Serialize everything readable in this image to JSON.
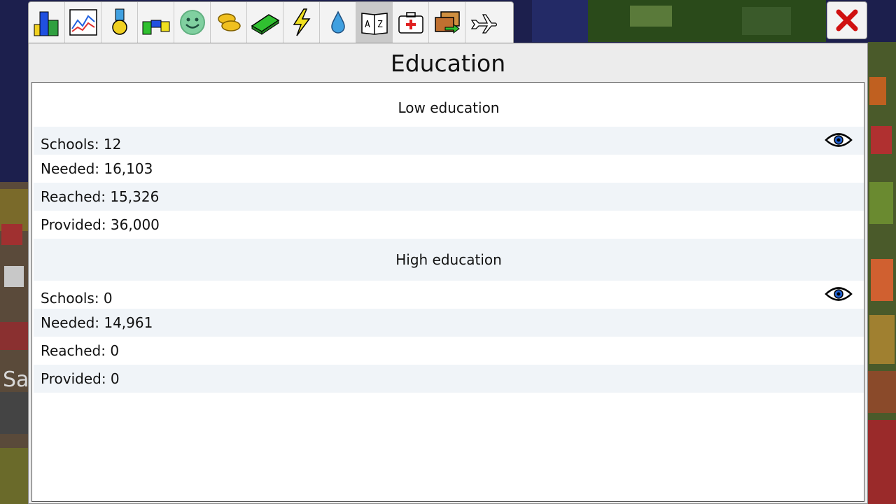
{
  "window": {
    "title": "Education"
  },
  "tabs": [
    {
      "icon": "buildings-icon"
    },
    {
      "icon": "graph-icon"
    },
    {
      "icon": "medal-icon"
    },
    {
      "icon": "zones-icon"
    },
    {
      "icon": "smiley-icon"
    },
    {
      "icon": "coins-icon"
    },
    {
      "icon": "money-icon"
    },
    {
      "icon": "lightning-icon"
    },
    {
      "icon": "water-drop-icon"
    },
    {
      "icon": "book-icon",
      "active": true
    },
    {
      "icon": "first-aid-icon"
    },
    {
      "icon": "transport-icon"
    },
    {
      "icon": "airplane-icon"
    }
  ],
  "close": {
    "icon": "close-icon"
  },
  "low": {
    "header": "Low education",
    "schools": "Schools: 12",
    "needed": "Needed: 16,103",
    "reached": "Reached: 15,326",
    "provided": "Provided: 36,000"
  },
  "high": {
    "header": "High education",
    "schools": "Schools: 0",
    "needed": "Needed: 14,961",
    "reached": "Reached: 0",
    "provided": "Provided: 0"
  },
  "colors": {
    "row_alt": "#f0f4f8",
    "accent_close": "#d01010"
  }
}
